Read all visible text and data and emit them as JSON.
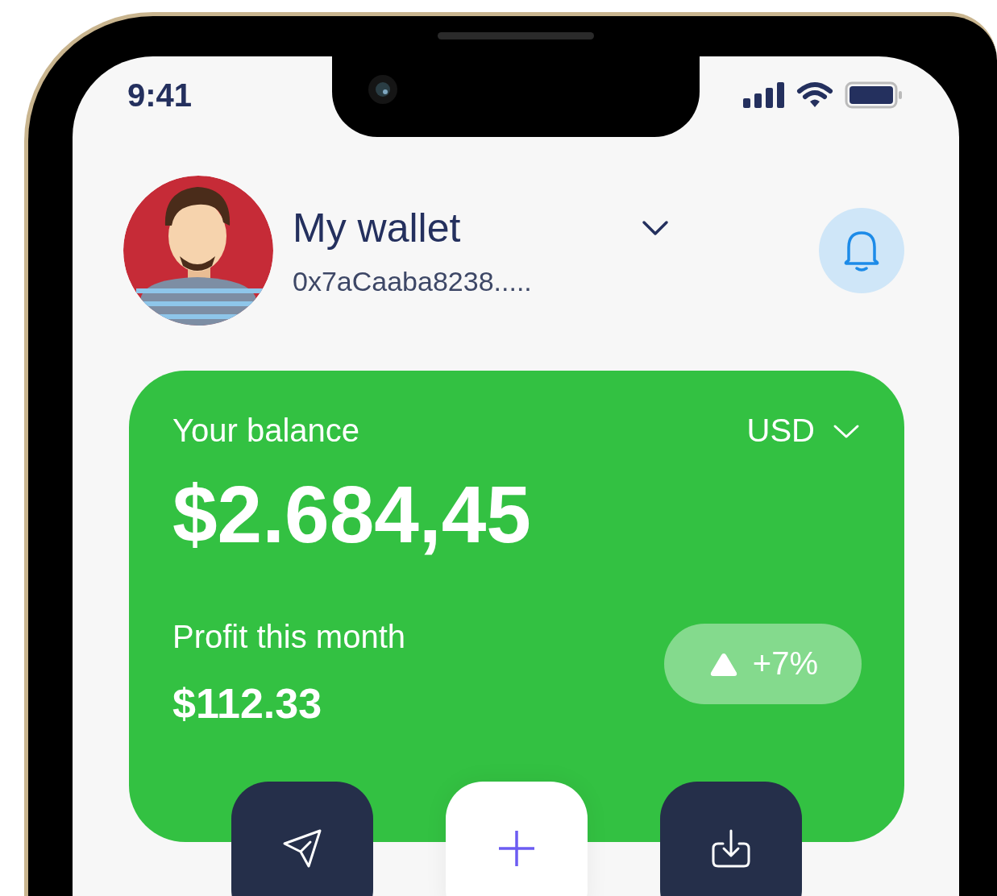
{
  "status_bar": {
    "time": "9:41"
  },
  "header": {
    "title": "My wallet",
    "address": "0x7aCaaba8238....."
  },
  "balance": {
    "label": "Your balance",
    "currency": "USD",
    "amount": "$2.684,45",
    "profit_label": "Profit this month",
    "profit": "$112.33",
    "change": "+7%",
    "rising": true
  },
  "actions": [
    {
      "kind": "send",
      "selected": false
    },
    {
      "kind": "add",
      "selected": true
    },
    {
      "kind": "receive",
      "selected": false
    }
  ]
}
